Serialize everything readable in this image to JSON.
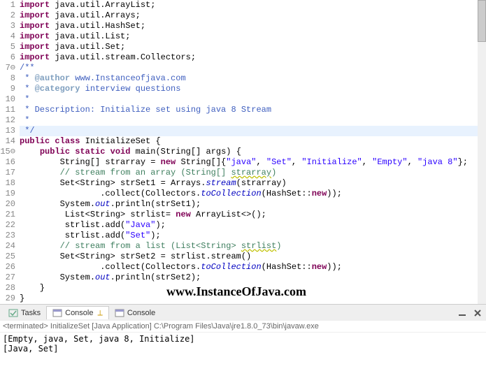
{
  "code": {
    "lines": [
      {
        "n": "1",
        "h": [
          [
            "kw",
            "import"
          ],
          [
            "",
            " java.util.ArrayList;"
          ]
        ]
      },
      {
        "n": "2",
        "h": [
          [
            "kw",
            "import"
          ],
          [
            "",
            " java.util.Arrays;"
          ]
        ]
      },
      {
        "n": "3",
        "h": [
          [
            "kw",
            "import"
          ],
          [
            "",
            " java.util.HashSet;"
          ]
        ]
      },
      {
        "n": "4",
        "h": [
          [
            "kw",
            "import"
          ],
          [
            "",
            " java.util.List;"
          ]
        ]
      },
      {
        "n": "5",
        "h": [
          [
            "kw",
            "import"
          ],
          [
            "",
            " java.util.Set;"
          ]
        ]
      },
      {
        "n": "6",
        "h": [
          [
            "kw",
            "import"
          ],
          [
            "",
            " java.util.stream.Collectors;"
          ]
        ]
      },
      {
        "n": "7",
        "icon": "⊖",
        "h": [
          [
            "jdoc",
            "/**"
          ]
        ]
      },
      {
        "n": "8",
        "h": [
          [
            "jdoc",
            " * "
          ],
          [
            "jtag",
            "@author"
          ],
          [
            "jdoc",
            " www.Instanceofjava.com"
          ]
        ]
      },
      {
        "n": "9",
        "h": [
          [
            "jdoc",
            " * "
          ],
          [
            "jtag",
            "@category"
          ],
          [
            "jdoc",
            " interview questions"
          ]
        ]
      },
      {
        "n": "10",
        "h": [
          [
            "jdoc",
            " *"
          ]
        ]
      },
      {
        "n": "11",
        "h": [
          [
            "jdoc",
            " * Description: Initialize set using java 8 Stream"
          ]
        ]
      },
      {
        "n": "12",
        "h": [
          [
            "jdoc",
            " *"
          ]
        ]
      },
      {
        "n": "13",
        "hl": true,
        "h": [
          [
            "jdoc",
            " */"
          ]
        ]
      },
      {
        "n": "14",
        "h": [
          [
            "kw",
            "public"
          ],
          [
            "",
            " "
          ],
          [
            "kw",
            "class"
          ],
          [
            "",
            " InitializeSet {"
          ]
        ]
      },
      {
        "n": "15",
        "icon": "⊖",
        "h": [
          [
            "",
            "    "
          ],
          [
            "kw",
            "public"
          ],
          [
            "",
            " "
          ],
          [
            "kw",
            "static"
          ],
          [
            "",
            " "
          ],
          [
            "kw",
            "void"
          ],
          [
            "",
            " main(String[] args) {"
          ]
        ]
      },
      {
        "n": "16",
        "h": [
          [
            "",
            "        String[] strarray = "
          ],
          [
            "kw",
            "new"
          ],
          [
            "",
            " String[]{"
          ],
          [
            "str",
            "\"java\""
          ],
          [
            "",
            ", "
          ],
          [
            "str",
            "\"Set\""
          ],
          [
            "",
            ", "
          ],
          [
            "str",
            "\"Initialize\""
          ],
          [
            "",
            ", "
          ],
          [
            "str",
            "\"Empty\""
          ],
          [
            "",
            ", "
          ],
          [
            "str",
            "\"java 8\""
          ],
          [
            "",
            "};"
          ]
        ]
      },
      {
        "n": "17",
        "h": [
          [
            "",
            "        "
          ],
          [
            "cmt",
            "// stream from an array (String[] "
          ],
          [
            "cmt wavy",
            "strarray"
          ],
          [
            "cmt",
            ")"
          ]
        ]
      },
      {
        "n": "18",
        "h": [
          [
            "",
            "        Set<String> strSet1 = Arrays."
          ],
          [
            "st",
            "stream"
          ],
          [
            "",
            "(strarray)"
          ]
        ]
      },
      {
        "n": "19",
        "h": [
          [
            "",
            "                .collect(Collectors."
          ],
          [
            "st",
            "toCollection"
          ],
          [
            "",
            "(HashSet::"
          ],
          [
            "kw",
            "new"
          ],
          [
            "",
            "));"
          ]
        ]
      },
      {
        "n": "20",
        "h": [
          [
            "",
            "        System."
          ],
          [
            "st",
            "out"
          ],
          [
            "",
            ".println(strSet1);"
          ]
        ]
      },
      {
        "n": "21",
        "h": [
          [
            "",
            "         List<String> strlist= "
          ],
          [
            "kw",
            "new"
          ],
          [
            "",
            " ArrayList<>();"
          ]
        ]
      },
      {
        "n": "22",
        "h": [
          [
            "",
            "         strlist.add("
          ],
          [
            "str",
            "\"Java\""
          ],
          [
            "",
            ");"
          ]
        ]
      },
      {
        "n": "23",
        "h": [
          [
            "",
            "         strlist.add("
          ],
          [
            "str",
            "\"Set\""
          ],
          [
            "",
            ");"
          ]
        ]
      },
      {
        "n": "24",
        "h": [
          [
            "",
            "        "
          ],
          [
            "cmt",
            "// stream from a list (List<String> "
          ],
          [
            "cmt wavy",
            "strlist"
          ],
          [
            "cmt",
            ")"
          ]
        ]
      },
      {
        "n": "25",
        "h": [
          [
            "",
            "        Set<String> strSet2 = strlist.stream()"
          ]
        ]
      },
      {
        "n": "26",
        "h": [
          [
            "",
            "                .collect(Collectors."
          ],
          [
            "st",
            "toCollection"
          ],
          [
            "",
            "(HashSet::"
          ],
          [
            "kw",
            "new"
          ],
          [
            "",
            "));"
          ]
        ]
      },
      {
        "n": "27",
        "h": [
          [
            "",
            "        System."
          ],
          [
            "st",
            "out"
          ],
          [
            "",
            ".println(strSet2);"
          ]
        ]
      },
      {
        "n": "28",
        "h": [
          [
            "",
            "    }"
          ]
        ]
      },
      {
        "n": "29",
        "h": [
          [
            "",
            "}"
          ]
        ]
      }
    ]
  },
  "watermark": "www.InstanceOfJava.com",
  "tabs": {
    "tasks": "Tasks",
    "console_active": "Console",
    "console_inactive": "Console",
    "close_x": "✕"
  },
  "console": {
    "status_prefix": "<terminated>",
    "status_main": " InitializeSet [Java Application] C:\\Program Files\\Java\\jre1.8.0_73\\bin\\javaw.exe",
    "line1": "[Empty, java, Set, java 8, Initialize]",
    "line2": "[Java, Set]"
  }
}
